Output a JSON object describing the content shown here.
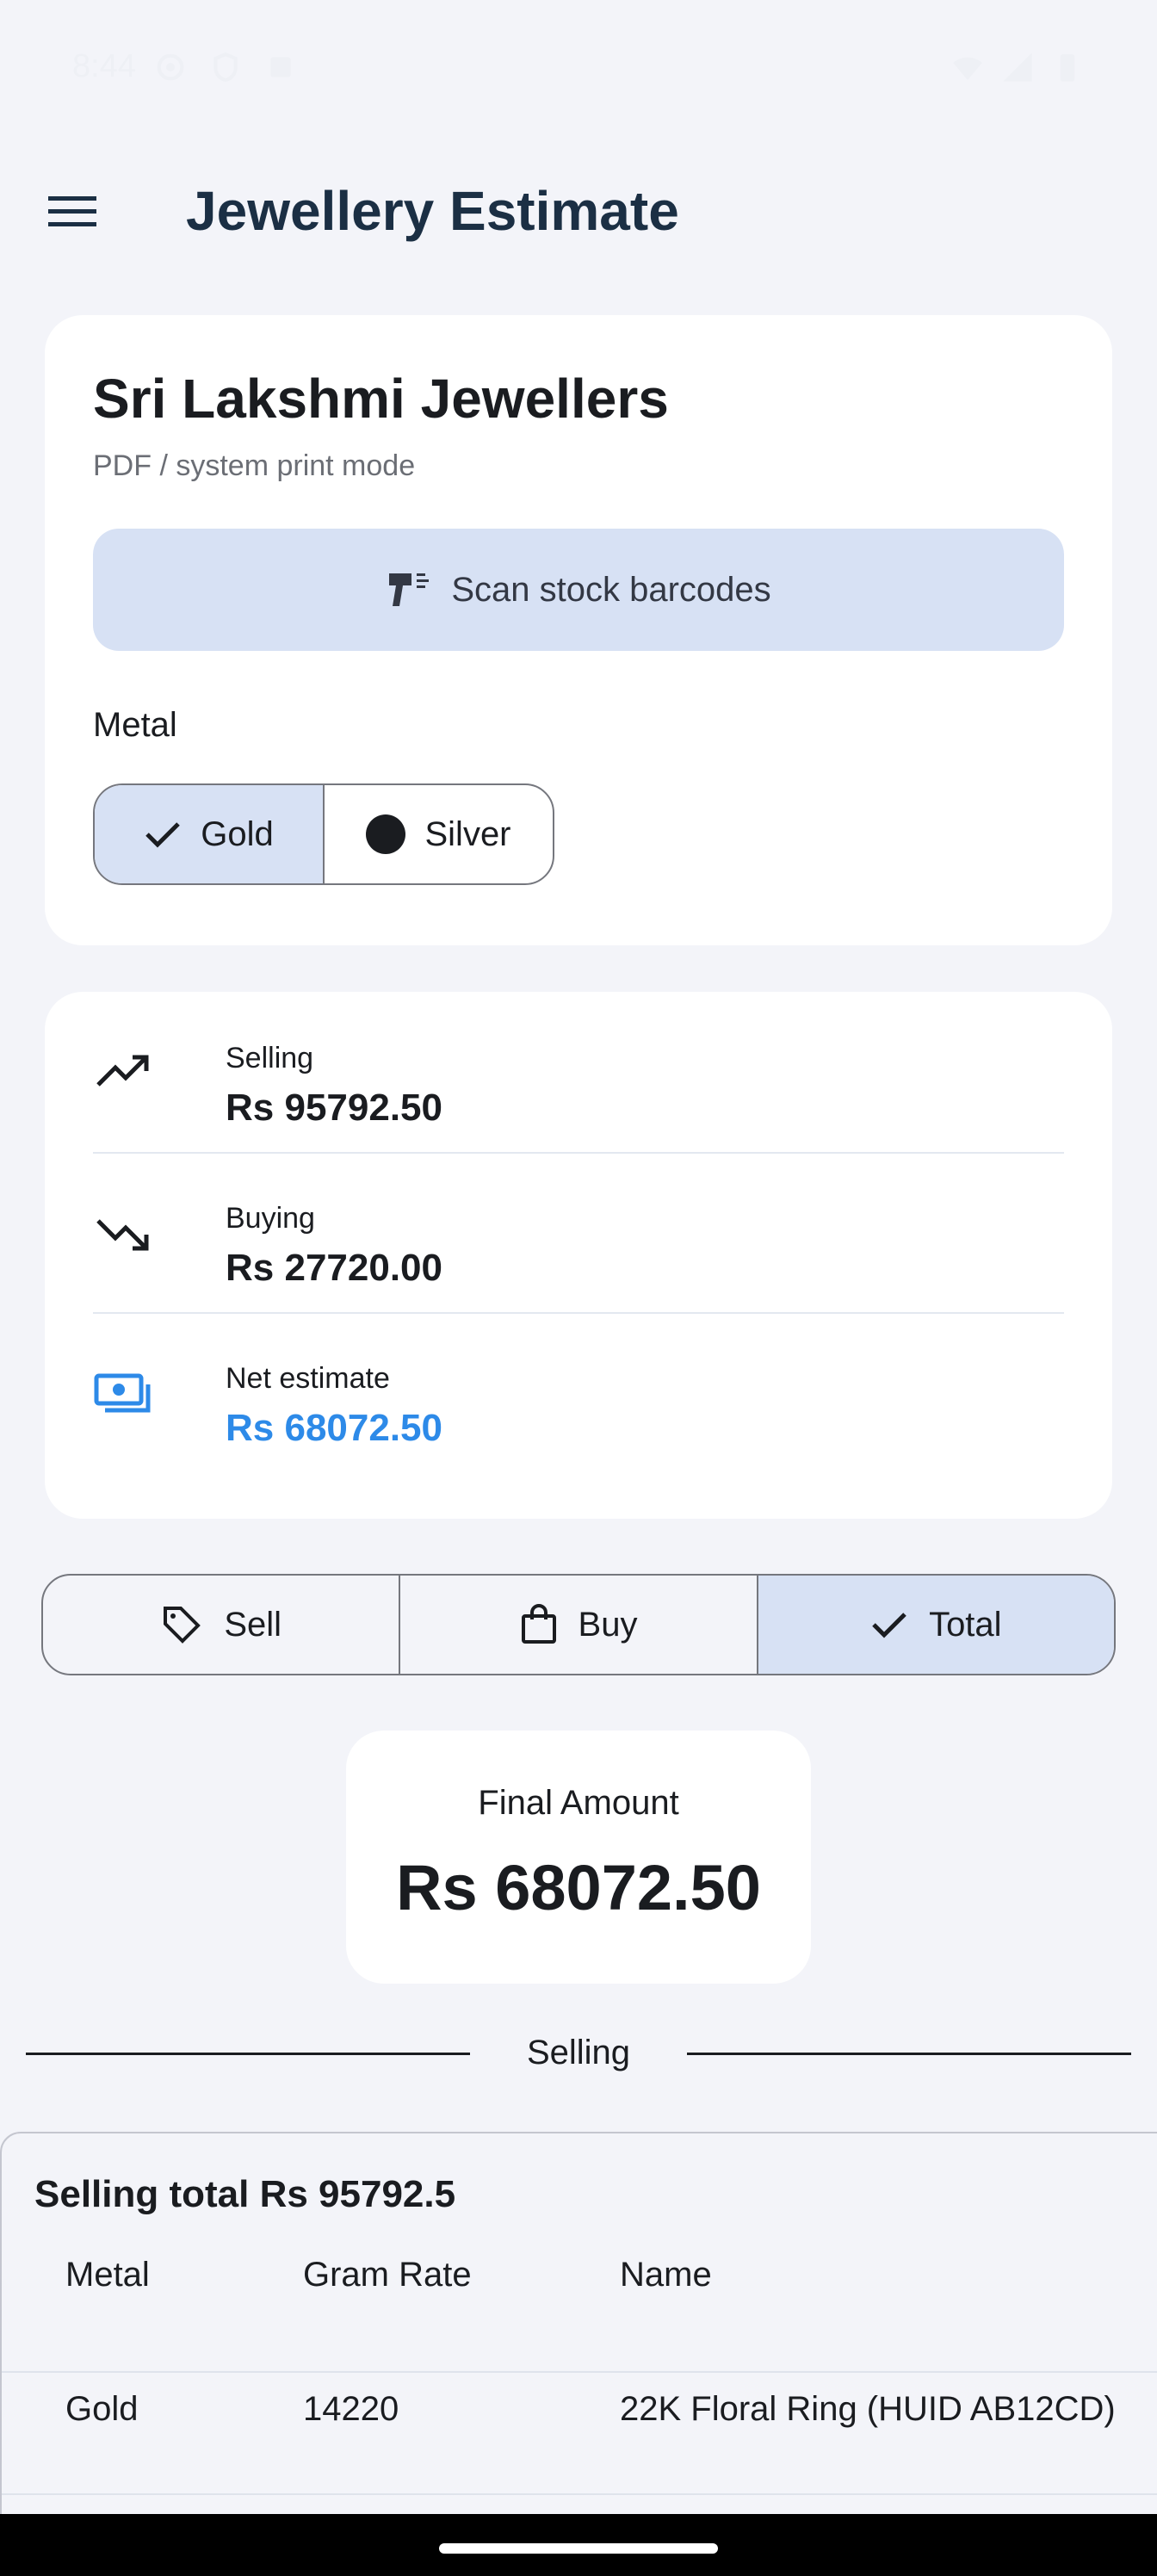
{
  "status_bar": {
    "time": "8:44",
    "left_icons": [
      "settings-icon",
      "shield-icon",
      "app-notification-icon"
    ],
    "right_icons": [
      "wifi-icon",
      "signal-icon",
      "battery-icon"
    ]
  },
  "app_bar": {
    "title": "Jewellery Estimate",
    "menu_icon": "hamburger-menu-icon"
  },
  "shop": {
    "name": "Sri Lakshmi Jewellers",
    "mode": "PDF / system print mode",
    "scan_label": "Scan stock barcodes",
    "metal_label": "Metal",
    "metal_options": [
      {
        "label": "Gold",
        "selected": true
      },
      {
        "label": "Silver",
        "selected": false
      }
    ]
  },
  "summary": {
    "selling_label": "Selling",
    "selling_value": "Rs 95792.50",
    "buying_label": "Buying",
    "buying_value": "Rs 27720.00",
    "net_label": "Net estimate",
    "net_value": "Rs 68072.50",
    "accent_color": "#2d8ae8"
  },
  "mode_tabs": [
    {
      "label": "Sell",
      "icon": "tag-icon",
      "selected": false
    },
    {
      "label": "Buy",
      "icon": "shopping-bag-icon",
      "selected": false
    },
    {
      "label": "Total",
      "icon": "check-icon",
      "selected": true
    }
  ],
  "final": {
    "label": "Final Amount",
    "value": "Rs 68072.50"
  },
  "section_divider": "Selling",
  "selling_table": {
    "title": "Selling total Rs 95792.5",
    "headers": [
      "Metal",
      "Gram Rate",
      "Name"
    ],
    "rows": [
      [
        "Gold",
        "14220",
        "22K Floral Ring (HUID AB12CD)"
      ]
    ]
  },
  "colors": {
    "selected_fill": "#d7e1f4",
    "title_color": "#1b2f44",
    "background": "#f3f4f9"
  }
}
